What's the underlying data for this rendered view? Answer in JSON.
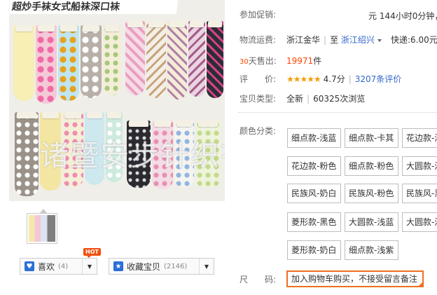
{
  "image": {
    "banner_text": "超炒手袜女式船袜深口袜",
    "watermark": "诸暨安步针织有限公司"
  },
  "actions": {
    "like": {
      "label": "喜欢",
      "count": "(4)",
      "icon": "heart-icon"
    },
    "collect": {
      "label": "收藏宝贝",
      "count": "(2146)",
      "icon": "star-icon"
    },
    "hot_badge": "HOT"
  },
  "info": {
    "promo": {
      "label": "参加促销:",
      "value": "元 144小时0分钟，"
    },
    "shipping": {
      "label": "物流运费:",
      "from": "浙江金华",
      "to_prefix": "至",
      "to": "浙江绍兴",
      "fee": "快递:6.00元"
    },
    "sales": {
      "label_num": "30",
      "label_text": "天售出:",
      "count": "19971",
      "unit": "件"
    },
    "rating": {
      "label": "评　　价:",
      "stars": "★★★★★",
      "score": "4.7分",
      "reviews": "3207条评价"
    },
    "type": {
      "label": "宝贝类型:",
      "condition": "全新",
      "views": "60325次浏览"
    },
    "color": {
      "label": "颜色分类:"
    },
    "size": {
      "label": "尺　　码:",
      "value": "加入购物车购买，不接受留言备注"
    }
  },
  "sku_options": [
    "细点款-浅蓝",
    "细点款-卡其",
    "花边款-浅",
    "花边款-粉色",
    "细点款-粉色",
    "大圆款-浅",
    "民族风-奶白",
    "民族风-粉色",
    "民族风-黑",
    "菱形款-黑色",
    "大圆款-浅蓝",
    "大圆款-浅",
    "菱形款-奶白",
    "细点款-浅紫"
  ],
  "colors": {
    "accent": "#f40",
    "link": "#3366cc",
    "star": "#f19f09",
    "size_border": "#ee6f21"
  }
}
